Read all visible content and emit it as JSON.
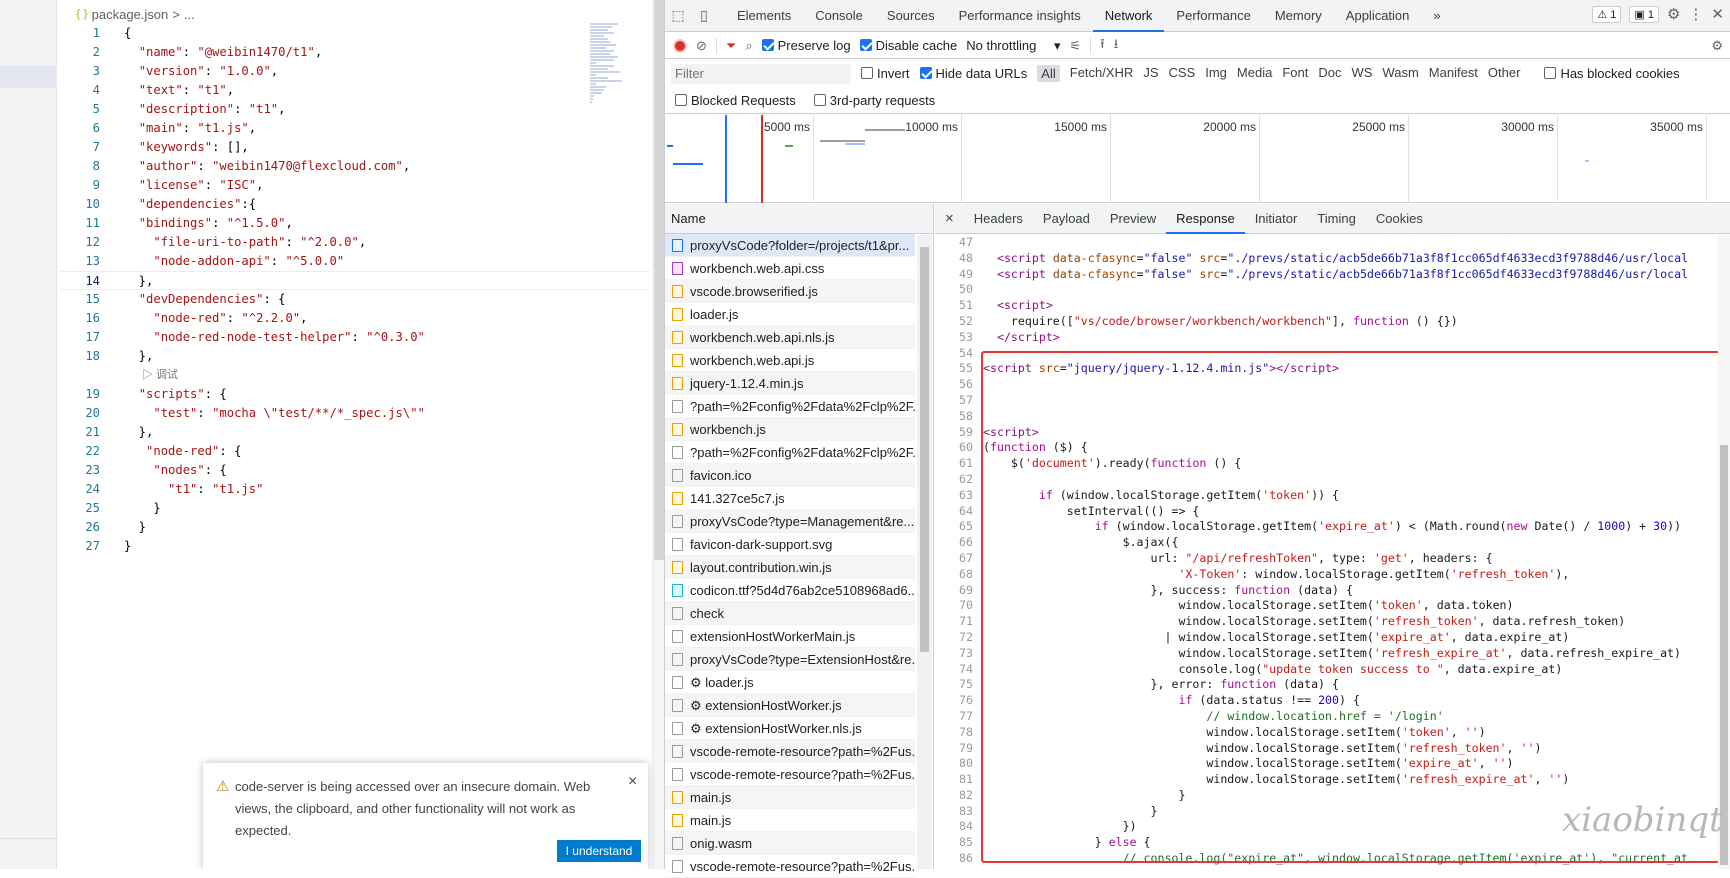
{
  "editor": {
    "breadcrumb": [
      "{ }",
      "package.json",
      ">",
      "..."
    ],
    "lines": [
      {
        "n": "1",
        "t": [
          [
            "p",
            "{"
          ]
        ]
      },
      {
        "n": "2",
        "t": [
          [
            "p",
            "  "
          ],
          [
            "k",
            "\"name\""
          ],
          [
            "p",
            ": "
          ],
          [
            "s",
            "\"@weibin1470/t1\""
          ],
          [
            "p",
            ","
          ]
        ]
      },
      {
        "n": "3",
        "t": [
          [
            "p",
            "  "
          ],
          [
            "k",
            "\"version\""
          ],
          [
            "p",
            ": "
          ],
          [
            "s",
            "\"1.0.0\""
          ],
          [
            "p",
            ","
          ]
        ]
      },
      {
        "n": "4",
        "t": [
          [
            "p",
            "  "
          ],
          [
            "k",
            "\"text\""
          ],
          [
            "p",
            ": "
          ],
          [
            "s",
            "\"t1\""
          ],
          [
            "p",
            ","
          ]
        ]
      },
      {
        "n": "5",
        "t": [
          [
            "p",
            "  "
          ],
          [
            "k",
            "\"description\""
          ],
          [
            "p",
            ": "
          ],
          [
            "s",
            "\"t1\""
          ],
          [
            "p",
            ","
          ]
        ]
      },
      {
        "n": "6",
        "t": [
          [
            "p",
            "  "
          ],
          [
            "k",
            "\"main\""
          ],
          [
            "p",
            ": "
          ],
          [
            "s",
            "\"t1.js\""
          ],
          [
            "p",
            ","
          ]
        ]
      },
      {
        "n": "7",
        "t": [
          [
            "p",
            "  "
          ],
          [
            "k",
            "\"keywords\""
          ],
          [
            "p",
            ": [],"
          ]
        ]
      },
      {
        "n": "8",
        "t": [
          [
            "p",
            "  "
          ],
          [
            "k",
            "\"author\""
          ],
          [
            "p",
            ": "
          ],
          [
            "s",
            "\"weibin1470@flexcloud.com\""
          ],
          [
            "p",
            ","
          ]
        ]
      },
      {
        "n": "9",
        "t": [
          [
            "p",
            "  "
          ],
          [
            "k",
            "\"license\""
          ],
          [
            "p",
            ": "
          ],
          [
            "s",
            "\"ISC\""
          ],
          [
            "p",
            ","
          ]
        ]
      },
      {
        "n": "10",
        "t": [
          [
            "p",
            "  "
          ],
          [
            "k",
            "\"dependencies\""
          ],
          [
            "p",
            ":{"
          ]
        ]
      },
      {
        "n": "11",
        "t": [
          [
            "p",
            "  "
          ],
          [
            "k",
            "\"bindings\""
          ],
          [
            "p",
            ": "
          ],
          [
            "s",
            "\"^1.5.0\""
          ],
          [
            "p",
            ","
          ]
        ]
      },
      {
        "n": "12",
        "t": [
          [
            "p",
            "    "
          ],
          [
            "k",
            "\"file-uri-to-path\""
          ],
          [
            "p",
            ": "
          ],
          [
            "s",
            "\"^2.0.0\""
          ],
          [
            "p",
            ","
          ]
        ]
      },
      {
        "n": "13",
        "t": [
          [
            "p",
            "    "
          ],
          [
            "k",
            "\"node-addon-api\""
          ],
          [
            "p",
            ": "
          ],
          [
            "s",
            "\"^5.0.0\""
          ]
        ]
      },
      {
        "n": "14",
        "t": [
          [
            "p",
            "  },"
          ]
        ],
        "cur": true
      },
      {
        "n": "15",
        "t": [
          [
            "p",
            "  "
          ],
          [
            "k",
            "\"devDependencies\""
          ],
          [
            "p",
            ": {"
          ]
        ]
      },
      {
        "n": "16",
        "t": [
          [
            "p",
            "    "
          ],
          [
            "k",
            "\"node-red\""
          ],
          [
            "p",
            ": "
          ],
          [
            "s",
            "\"^2.2.0\""
          ],
          [
            "p",
            ","
          ]
        ]
      },
      {
        "n": "17",
        "t": [
          [
            "p",
            "    "
          ],
          [
            "k",
            "\"node-red-node-test-helper\""
          ],
          [
            "p",
            ": "
          ],
          [
            "s",
            "\"^0.3.0\""
          ]
        ]
      },
      {
        "n": "18",
        "t": [
          [
            "p",
            "  },"
          ]
        ]
      },
      {
        "lens": "▷ 调试"
      },
      {
        "n": "19",
        "t": [
          [
            "p",
            "  "
          ],
          [
            "k",
            "\"scripts\""
          ],
          [
            "p",
            ": {"
          ]
        ]
      },
      {
        "n": "20",
        "t": [
          [
            "p",
            "    "
          ],
          [
            "k",
            "\"test\""
          ],
          [
            "p",
            ": "
          ],
          [
            "s",
            "\"mocha \\\"test/**/*_spec.js\\\"\""
          ]
        ]
      },
      {
        "n": "21",
        "t": [
          [
            "p",
            "  },"
          ]
        ]
      },
      {
        "n": "22",
        "t": [
          [
            "p",
            "   "
          ],
          [
            "k",
            "\"node-red\""
          ],
          [
            "p",
            ": {"
          ]
        ]
      },
      {
        "n": "23",
        "t": [
          [
            "p",
            "    "
          ],
          [
            "k",
            "\"nodes\""
          ],
          [
            "p",
            ": {"
          ]
        ]
      },
      {
        "n": "24",
        "t": [
          [
            "p",
            "      "
          ],
          [
            "k",
            "\"t1\""
          ],
          [
            "p",
            ": "
          ],
          [
            "s",
            "\"t1.js\""
          ]
        ]
      },
      {
        "n": "25",
        "t": [
          [
            "p",
            "    }"
          ]
        ]
      },
      {
        "n": "26",
        "t": [
          [
            "p",
            "  }"
          ]
        ]
      },
      {
        "n": "27",
        "t": [
          [
            "p",
            "}"
          ]
        ]
      }
    ]
  },
  "notification": {
    "message": "code-server is being accessed over an insecure domain. Web views, the clipboard, and other functionality will not work as expected.",
    "button": "I understand",
    "close": "×",
    "icon": "warning-icon"
  },
  "devtools": {
    "tabs": [
      "Elements",
      "Console",
      "Sources",
      "Performance insights",
      "Network",
      "Performance",
      "Memory",
      "Application"
    ],
    "selected_tab": "Network",
    "more": "»",
    "warnings": "1",
    "messages": "1",
    "toolbar": {
      "preserve_log": "Preserve log",
      "disable_cache": "Disable cache",
      "throttling": "No throttling",
      "preserve_checked": true,
      "disable_checked": true
    },
    "filter": {
      "placeholder": "Filter",
      "invert": "Invert",
      "hide_data": "Hide data URLs",
      "types": [
        "All",
        "Fetch/XHR",
        "JS",
        "CSS",
        "Img",
        "Media",
        "Font",
        "Doc",
        "WS",
        "Wasm",
        "Manifest",
        "Other"
      ],
      "blocked_cookies": "Has blocked cookies",
      "blocked_requests": "Blocked Requests",
      "third_party": "3rd-party requests"
    },
    "timeline_ticks": [
      "5000 ms",
      "10000 ms",
      "15000 ms",
      "20000 ms",
      "25000 ms",
      "30000 ms",
      "35000 ms"
    ],
    "name_header": "Name",
    "requests": [
      {
        "name": "proxyVsCode?folder=/projects/t1&pr...",
        "kind": "doc",
        "sel": true
      },
      {
        "name": "workbench.web.api.css",
        "kind": "css"
      },
      {
        "name": "vscode.browserified.js",
        "kind": "js"
      },
      {
        "name": "loader.js",
        "kind": "js"
      },
      {
        "name": "workbench.web.api.nls.js",
        "kind": "js"
      },
      {
        "name": "workbench.web.api.js",
        "kind": "js"
      },
      {
        "name": "jquery-1.12.4.min.js",
        "kind": "js"
      },
      {
        "name": "?path=%2Fconfig%2Fdata%2Fclp%2F...",
        "kind": "other"
      },
      {
        "name": "workbench.js",
        "kind": "js"
      },
      {
        "name": "?path=%2Fconfig%2Fdata%2Fclp%2F...",
        "kind": "other"
      },
      {
        "name": "favicon.ico",
        "kind": "other"
      },
      {
        "name": "141.327ce5c7.js",
        "kind": "js"
      },
      {
        "name": "proxyVsCode?type=Management&re...",
        "kind": "other"
      },
      {
        "name": "favicon-dark-support.svg",
        "kind": "other"
      },
      {
        "name": "layout.contribution.win.js",
        "kind": "js"
      },
      {
        "name": "codicon.ttf?5d4d76ab2ce5108968ad6...",
        "kind": "font"
      },
      {
        "name": "check",
        "kind": "other"
      },
      {
        "name": "extensionHostWorkerMain.js",
        "kind": "other"
      },
      {
        "name": "proxyVsCode?type=ExtensionHost&re...",
        "kind": "other"
      },
      {
        "name": "⚙ loader.js",
        "kind": "other"
      },
      {
        "name": "⚙ extensionHostWorker.js",
        "kind": "other"
      },
      {
        "name": "⚙ extensionHostWorker.nls.js",
        "kind": "other"
      },
      {
        "name": "vscode-remote-resource?path=%2Fus...",
        "kind": "other"
      },
      {
        "name": "vscode-remote-resource?path=%2Fus...",
        "kind": "other"
      },
      {
        "name": "main.js",
        "kind": "js"
      },
      {
        "name": "main.js",
        "kind": "js"
      },
      {
        "name": "onig.wasm",
        "kind": "other"
      },
      {
        "name": "vscode-remote-resource?path=%2Fus...",
        "kind": "other"
      }
    ],
    "detail_close": "×",
    "detail_tabs": [
      "Headers",
      "Payload",
      "Preview",
      "Response",
      "Initiator",
      "Timing",
      "Cookies"
    ],
    "detail_selected": "Response",
    "response_lines": [
      {
        "n": "47",
        "h": ""
      },
      {
        "n": "48",
        "h": "  <t>&lt;script</t> <a>data-cfasync</a>=<q>\"false\"</q> <a>src</a>=<q>\"./prevs/static/acb5de66b71a3f8f1cc065df4633ecd3f9788d46/usr/local</q>"
      },
      {
        "n": "49",
        "h": "  <t>&lt;script</t> <a>data-cfasync</a>=<q>\"false\"</q> <a>src</a>=<q>\"./prevs/static/acb5de66b71a3f8f1cc065df4633ecd3f9788d46/usr/local</q>"
      },
      {
        "n": "50",
        "h": ""
      },
      {
        "n": "51",
        "h": "  <t>&lt;script&gt;</t>"
      },
      {
        "n": "52",
        "h": "    require([<str>\"vs/code/browser/workbench/workbench\"</str>], <kw>function</kw> () {})"
      },
      {
        "n": "53",
        "h": "  <t>&lt;/script&gt;</t>"
      },
      {
        "n": "54",
        "h": ""
      },
      {
        "n": "55",
        "h": "<t>&lt;script</t> <a>src</a>=<q>\"jquery/jquery-1.12.4.min.js\"</q><t>&gt;&lt;/script&gt;</t>"
      },
      {
        "n": "56",
        "h": ""
      },
      {
        "n": "57",
        "h": ""
      },
      {
        "n": "58",
        "h": ""
      },
      {
        "n": "59",
        "h": "<t>&lt;script&gt;</t>"
      },
      {
        "n": "60",
        "h": "(<kw>function</kw> ($) {"
      },
      {
        "n": "61",
        "h": "    $(<str>'document'</str>).ready(<kw>function</kw> () {"
      },
      {
        "n": "62",
        "h": ""
      },
      {
        "n": "63",
        "h": "        <kw>if</kw> (window.localStorage.getItem(<str>'token'</str>)) {"
      },
      {
        "n": "64",
        "h": "            setInterval(() =&gt; {"
      },
      {
        "n": "65",
        "h": "                <kw>if</kw> (window.localStorage.getItem(<str>'expire_at'</str>) &lt; (Math.round(<kw>new</kw> Date() / <num>1000</num>) + <num>30</num>))"
      },
      {
        "n": "66",
        "h": "                    $.ajax({"
      },
      {
        "n": "67",
        "h": "                        url: <str>\"/api/refreshToken\"</str>, type: <str>'get'</str>, headers: {"
      },
      {
        "n": "68",
        "h": "                            <str>'X-Token'</str>: window.localStorage.getItem(<str>'refresh_token'</str>),"
      },
      {
        "n": "69",
        "h": "                        }, success: <kw>function</kw> (data) {"
      },
      {
        "n": "70",
        "h": "                            window.localStorage.setItem(<str>'token'</str>, data.token)"
      },
      {
        "n": "71",
        "h": "                            window.localStorage.setItem(<str>'refresh_token'</str>, data.refresh_token)"
      },
      {
        "n": "72",
        "h": "                          | window.localStorage.setItem(<str>'expire_at'</str>, data.expire_at)"
      },
      {
        "n": "73",
        "h": "                            window.localStorage.setItem(<str>'refresh_expire_at'</str>, data.refresh_expire_at)"
      },
      {
        "n": "74",
        "h": "                            console.log(<str>\"update token success to \"</str>, data.expire_at)"
      },
      {
        "n": "75",
        "h": "                        }, error: <kw>function</kw> (data) {"
      },
      {
        "n": "76",
        "h": "                            <kw>if</kw> (data.status !== <num>200</num>) {"
      },
      {
        "n": "77",
        "h": "                                <cm>// window.location.href = '/login'</cm>"
      },
      {
        "n": "78",
        "h": "                                window.localStorage.setItem(<str>'token'</str>, <str>''</str>)"
      },
      {
        "n": "79",
        "h": "                                window.localStorage.setItem(<str>'refresh_token'</str>, <str>''</str>)"
      },
      {
        "n": "80",
        "h": "                                window.localStorage.setItem(<str>'expire_at'</str>, <str>''</str>)"
      },
      {
        "n": "81",
        "h": "                                window.localStorage.setItem(<str>'refresh_expire_at'</str>, <str>''</str>)"
      },
      {
        "n": "82",
        "h": "                            }"
      },
      {
        "n": "83",
        "h": "                        }"
      },
      {
        "n": "84",
        "h": "                    })"
      },
      {
        "n": "85",
        "h": "                } <kw>else</kw> {"
      },
      {
        "n": "86",
        "h": "                    <cm>// console.log(\"expire_at\", window.localStorage.getItem('expire_at'), \"current_at</cm>"
      }
    ]
  },
  "watermark": "xiaobinqt",
  "colors": {
    "accent": "#1a73e8",
    "highlight_box": "#e23a3a",
    "record": "#d93025"
  }
}
